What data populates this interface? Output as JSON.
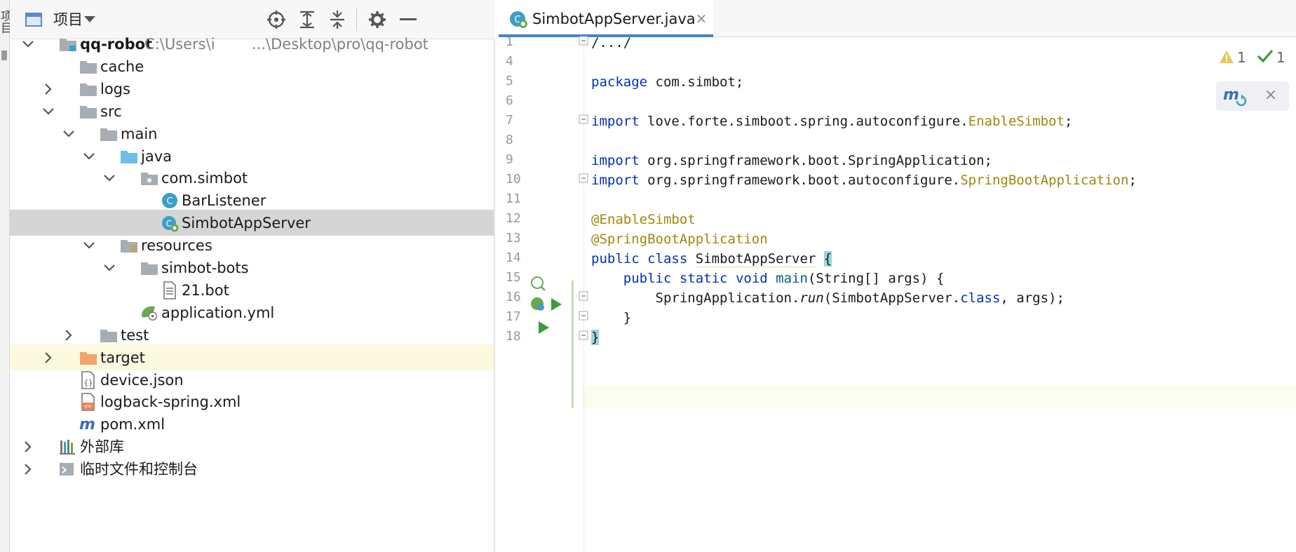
{
  "sidebar_stripe_label": "项目",
  "project_panel": {
    "title": "项目",
    "toolbar_icons": [
      "target-icon",
      "expand-all-icon",
      "collapse-all-icon",
      "gear-icon",
      "minimize-icon"
    ],
    "tree": [
      {
        "label": "qq-robot",
        "path": "C:\\Users\\i     ...\\Desktop\\pro\\qq-robot",
        "bold": true,
        "arrow": "down",
        "icon": "module-folder-icon",
        "indent": 0
      },
      {
        "label": "cache",
        "arrow": "none",
        "icon": "folder-icon",
        "indent": 1
      },
      {
        "label": "logs",
        "arrow": "right",
        "icon": "folder-icon",
        "indent": 1
      },
      {
        "label": "src",
        "arrow": "down",
        "icon": "folder-icon",
        "indent": 1
      },
      {
        "label": "main",
        "arrow": "down",
        "icon": "folder-icon",
        "indent": 2
      },
      {
        "label": "java",
        "arrow": "down",
        "icon": "source-folder-icon",
        "indent": 3
      },
      {
        "label": "com.simbot",
        "arrow": "down",
        "icon": "package-icon",
        "indent": 4
      },
      {
        "label": "BarListener",
        "arrow": "none",
        "icon": "class-icon",
        "indent": 5
      },
      {
        "label": "SimbotAppServer",
        "arrow": "none",
        "icon": "spring-class-icon",
        "indent": 5,
        "selected": true
      },
      {
        "label": "resources",
        "arrow": "down",
        "icon": "resources-folder-icon",
        "indent": 3
      },
      {
        "label": "simbot-bots",
        "arrow": "down",
        "icon": "folder-icon",
        "indent": 4
      },
      {
        "label": "21.bot",
        "arrow": "none",
        "icon": "text-file-icon",
        "indent": 5
      },
      {
        "label": "application.yml",
        "arrow": "none",
        "icon": "spring-config-icon",
        "indent": 4
      },
      {
        "label": "test",
        "arrow": "right",
        "icon": "folder-icon",
        "indent": 2
      },
      {
        "label": "target",
        "arrow": "right",
        "icon": "excluded-folder-icon",
        "indent": 1,
        "excluded": true
      },
      {
        "label": "device.json",
        "arrow": "none",
        "icon": "json-file-icon",
        "indent": 1
      },
      {
        "label": "logback-spring.xml",
        "arrow": "none",
        "icon": "xml-file-icon",
        "indent": 1
      },
      {
        "label": "pom.xml",
        "arrow": "none",
        "icon": "maven-icon",
        "indent": 1
      },
      {
        "label": "外部库",
        "arrow": "right",
        "icon": "library-icon",
        "indent": 0
      },
      {
        "label": "临时文件和控制台",
        "arrow": "right",
        "icon": "scratch-icon",
        "indent": 0
      }
    ]
  },
  "editor": {
    "tab": {
      "label": "SimbotAppServer.java",
      "close": "×"
    },
    "inspections": {
      "warnings": "1",
      "ok": "1"
    },
    "maven_popup": {
      "close": "×"
    },
    "line_numbers": [
      "1",
      "4",
      "5",
      "6",
      "7",
      "8",
      "9",
      "10",
      "11",
      "12",
      "13",
      "14",
      "15",
      "16",
      "17",
      "18"
    ],
    "code": [
      {
        "n": "1",
        "segs": [
          [
            "/.../",
            ""
          ]
        ]
      },
      {
        "n": "4",
        "segs": []
      },
      {
        "n": "5",
        "segs": [
          [
            "package",
            "kw"
          ],
          [
            " com.simbot;",
            ""
          ]
        ]
      },
      {
        "n": "6",
        "segs": []
      },
      {
        "n": "7",
        "segs": [
          [
            "import",
            "kw"
          ],
          [
            " love.forte.simboot.spring.autoconfigure.",
            ""
          ],
          [
            "EnableSimbot",
            "cls"
          ],
          [
            ";",
            ""
          ]
        ]
      },
      {
        "n": "8",
        "segs": []
      },
      {
        "n": "9",
        "segs": [
          [
            "import",
            "kw"
          ],
          [
            " org.springframework.boot.SpringApplication;",
            ""
          ]
        ]
      },
      {
        "n": "10",
        "segs": [
          [
            "import",
            "kw"
          ],
          [
            " org.springframework.boot.autoconfigure.",
            ""
          ],
          [
            "SpringBootApplication",
            "cls"
          ],
          [
            ";",
            ""
          ]
        ]
      },
      {
        "n": "11",
        "segs": []
      },
      {
        "n": "12",
        "segs": [
          [
            "@EnableSimbot",
            "ann"
          ]
        ]
      },
      {
        "n": "13",
        "segs": [
          [
            "@SpringBootApplication",
            "ann"
          ]
        ]
      },
      {
        "n": "14",
        "segs": [
          [
            "public",
            "kw"
          ],
          [
            " ",
            ""
          ],
          [
            "class",
            "kw"
          ],
          [
            " ",
            ""
          ],
          [
            "SimbotAppServer",
            "squiggle"
          ],
          [
            " ",
            ""
          ],
          [
            "{",
            "brace"
          ]
        ]
      },
      {
        "n": "15",
        "segs": [
          [
            "    ",
            ""
          ],
          [
            "public",
            "kw"
          ],
          [
            " ",
            ""
          ],
          [
            "static",
            "kw"
          ],
          [
            " ",
            ""
          ],
          [
            "void",
            "kw"
          ],
          [
            " ",
            ""
          ],
          [
            "main",
            "fn"
          ],
          [
            "(String[] args) {",
            ""
          ]
        ]
      },
      {
        "n": "16",
        "segs": [
          [
            "        SpringApplication.",
            ""
          ],
          [
            "run",
            "it"
          ],
          [
            "(SimbotAppServer.",
            ""
          ],
          [
            "class",
            "kw"
          ],
          [
            ", args);",
            ""
          ]
        ]
      },
      {
        "n": "17",
        "segs": [
          [
            "    }",
            ""
          ]
        ]
      },
      {
        "n": "18",
        "segs": [
          [
            "}",
            "brace"
          ]
        ]
      }
    ]
  }
}
